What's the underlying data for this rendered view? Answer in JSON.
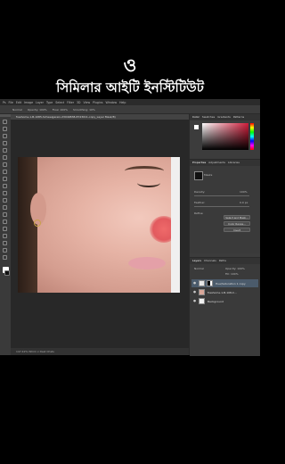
{
  "brand": {
    "logo_text": "ও",
    "title": "সিমিলার আইটি ইনস্টিটিউট"
  },
  "menu": [
    "Ps",
    "File",
    "Edit",
    "Image",
    "Layer",
    "Type",
    "Select",
    "Filter",
    "3D",
    "View",
    "Plugins",
    "Window",
    "Help"
  ],
  "options_bar": {
    "mode": "Normal",
    "opacity_label": "Opacity: 100%",
    "flow_label": "Flow: 100%",
    "smoothing_label": "Smoothing: 10%"
  },
  "document": {
    "tab_title": "freshome-1-B-1085-Schweigerein-23049838-8743011-copy_Layer Mask/8)",
    "status": "147.42%   Whim x Dest Chsts"
  },
  "color_panel": {
    "tabs": [
      "Color",
      "Swatches",
      "Gradients",
      "Patterns"
    ],
    "accent": "#d01c3a"
  },
  "properties": {
    "tabs": [
      "Properties",
      "Adjustments",
      "Libraries"
    ],
    "mask_label": "Masks",
    "density_label": "Density:",
    "density_value": "100%",
    "feather_label": "Feather:",
    "feather_value": "0.0 px",
    "refine_label": "Refine:",
    "buttons": [
      "Select and Mask...",
      "Color Range...",
      "Invert"
    ]
  },
  "layers": {
    "tabs": [
      "Layers",
      "Channels",
      "Paths"
    ],
    "blend": "Normal",
    "opacity": "Opacity: 100%",
    "fill": "Fill: 100%",
    "items": [
      {
        "name": "Hue/Saturation 1 copy"
      },
      {
        "name": "freshome-1-B-108-C..."
      },
      {
        "name": "Background"
      }
    ]
  }
}
